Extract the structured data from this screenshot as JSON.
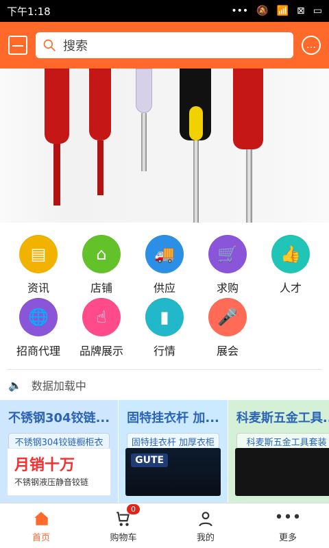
{
  "status": {
    "time": "下午1:18",
    "battery": "▭"
  },
  "search": {
    "placeholder": "搜索"
  },
  "grid": [
    {
      "label": "资讯",
      "color": "#f2b300",
      "icon": "news-icon"
    },
    {
      "label": "店铺",
      "color": "#63c229",
      "icon": "store-icon"
    },
    {
      "label": "供应",
      "color": "#2b8fe6",
      "icon": "supply-icon"
    },
    {
      "label": "求购",
      "color": "#8a55d8",
      "icon": "buy-icon"
    },
    {
      "label": "人才",
      "color": "#20c5b8",
      "icon": "talent-icon"
    },
    {
      "label": "招商代理",
      "color": "#8a55d8",
      "icon": "agent-icon"
    },
    {
      "label": "品牌展示",
      "color": "#ff4b8a",
      "icon": "brand-icon"
    },
    {
      "label": "行情",
      "color": "#22b7c9",
      "icon": "market-icon"
    },
    {
      "label": "展会",
      "color": "#ff6b57",
      "icon": "expo-icon"
    }
  ],
  "notice": {
    "text": "数据加载中"
  },
  "cards": [
    {
      "title": "不锈钢304铰链...",
      "subtitle": "不锈钢304铰链橱柜衣",
      "bg": "#cfe6ff",
      "subbg": "#e9f5ff",
      "inner_text": "月销十万",
      "inner_sub": "不锈钢液压静音铰链"
    },
    {
      "title": "固特挂衣杆 加...",
      "subtitle": "固特挂衣杆 加厚衣柜",
      "bg": "#cbe9ff",
      "subbg": "#eef8ff",
      "inner_text": "GUTE"
    },
    {
      "title": "科麦斯五金工具...",
      "subtitle": "科麦斯五金工具套装",
      "bg": "#d4f0d7",
      "subbg": "#effaf0"
    }
  ],
  "bottom": [
    {
      "label": "首页",
      "icon": "home-icon",
      "active": true
    },
    {
      "label": "购物车",
      "icon": "cart-icon",
      "badge": "0",
      "active": false
    },
    {
      "label": "我的",
      "icon": "user-icon",
      "active": false
    },
    {
      "label": "更多",
      "icon": "more-icon",
      "active": false
    }
  ]
}
